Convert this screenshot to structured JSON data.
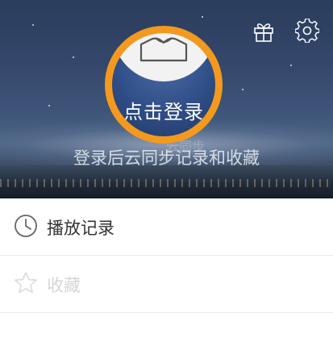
{
  "header": {
    "login_label": "点击登录",
    "sync_hint": "登录后云同步记录和收藏",
    "overlap_text": "云同步",
    "gift_icon": "gift-icon",
    "settings_icon": "gear-icon"
  },
  "menu": {
    "items": [
      {
        "label": "播放记录",
        "icon": "clock-icon"
      },
      {
        "label": "收藏",
        "icon": "star-icon"
      }
    ]
  },
  "colors": {
    "accent_ring": "#f39a1e",
    "menu_text": "#333333",
    "divider": "#e8e8e8"
  }
}
